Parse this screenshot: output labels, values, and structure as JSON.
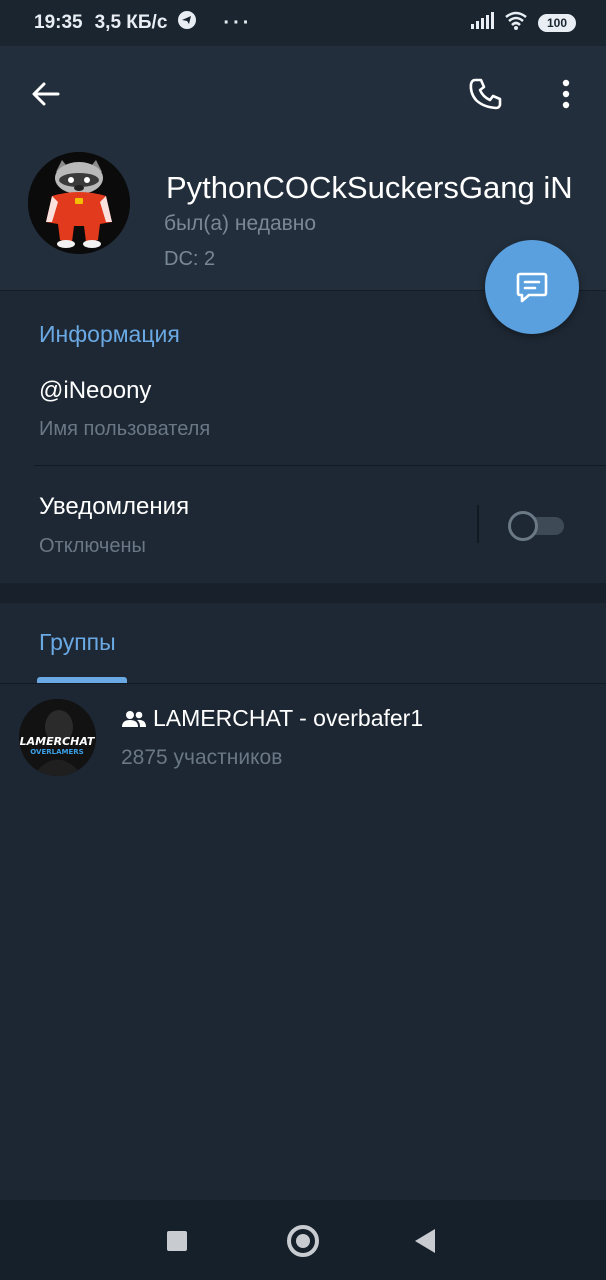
{
  "status_bar": {
    "time": "19:35",
    "speed": "3,5 КБ/с",
    "dots": "···",
    "battery": "100"
  },
  "toolbar": {
    "back_icon": "arrow-left-icon",
    "call_icon": "phone-icon",
    "more_icon": "more-vertical-icon"
  },
  "profile": {
    "name": "PythonCOCkSuckersGang    iN",
    "status": "был(а) недавно",
    "dc": "DC: 2",
    "avatar_icon": "raccoon-avatar"
  },
  "fab": {
    "icon": "message-icon"
  },
  "info": {
    "title": "Информация",
    "username_value": "@iNeoony",
    "username_label": "Имя пользователя",
    "notifications_label": "Уведомления",
    "notifications_value": "Отключены",
    "notifications_enabled": false
  },
  "groups": {
    "tab_title": "Группы",
    "items": [
      {
        "name": "LAMERCHAT - overbafer1",
        "members": "2875 участников",
        "avatar_text_top": "LAMERCHAT",
        "avatar_text_bottom": "OVERLAMERS",
        "icon": "group-icon"
      }
    ]
  },
  "nav": {
    "recents_icon": "square-icon",
    "home_icon": "circle-icon",
    "back_icon": "triangle-back-icon"
  },
  "colors": {
    "background": "#1d2733",
    "header": "#222e3b",
    "accent": "#6aa9e3",
    "fab": "#5aa0df",
    "secondary_text": "#6a7785"
  }
}
